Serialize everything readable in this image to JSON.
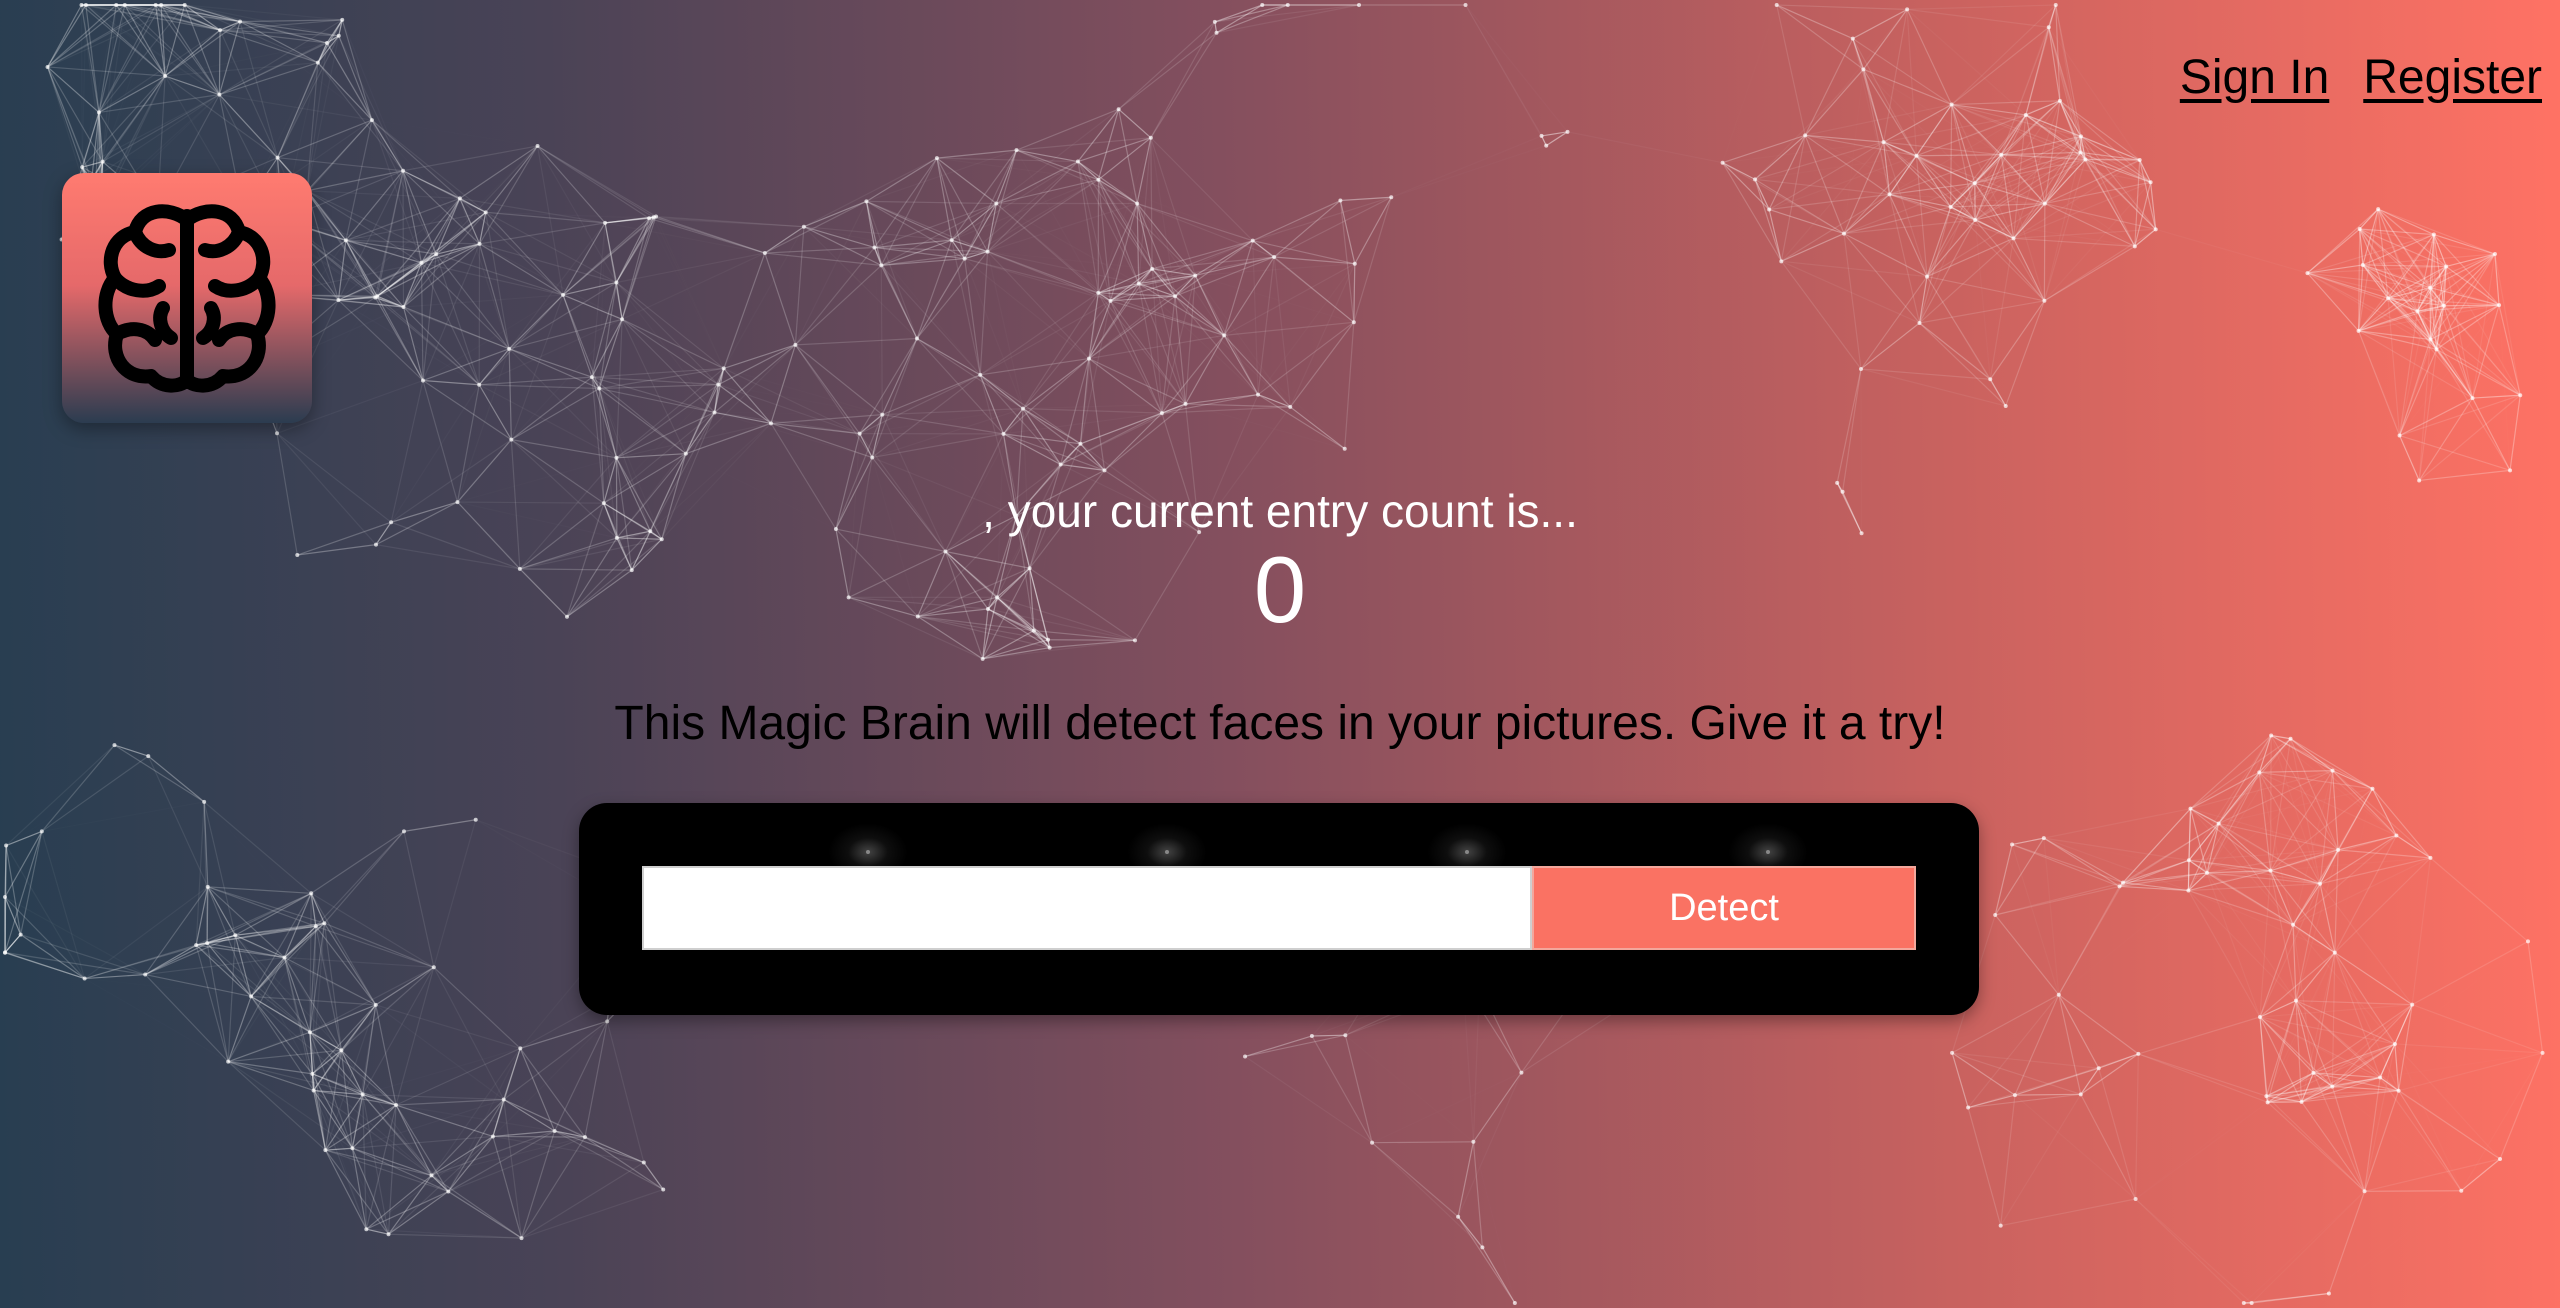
{
  "nav": {
    "sign_in": "Sign In",
    "register": "Register"
  },
  "logo": {
    "icon": "brain-icon"
  },
  "rank": {
    "message": ", your current entry count is...",
    "count": "0"
  },
  "form": {
    "tagline": "This Magic Brain will detect faces in your pictures. Give it a try!",
    "input_value": "",
    "button_label": "Detect"
  },
  "colors": {
    "gradient_start": "#283e51",
    "gradient_end": "#ff7264",
    "accent": "#fa7263"
  }
}
